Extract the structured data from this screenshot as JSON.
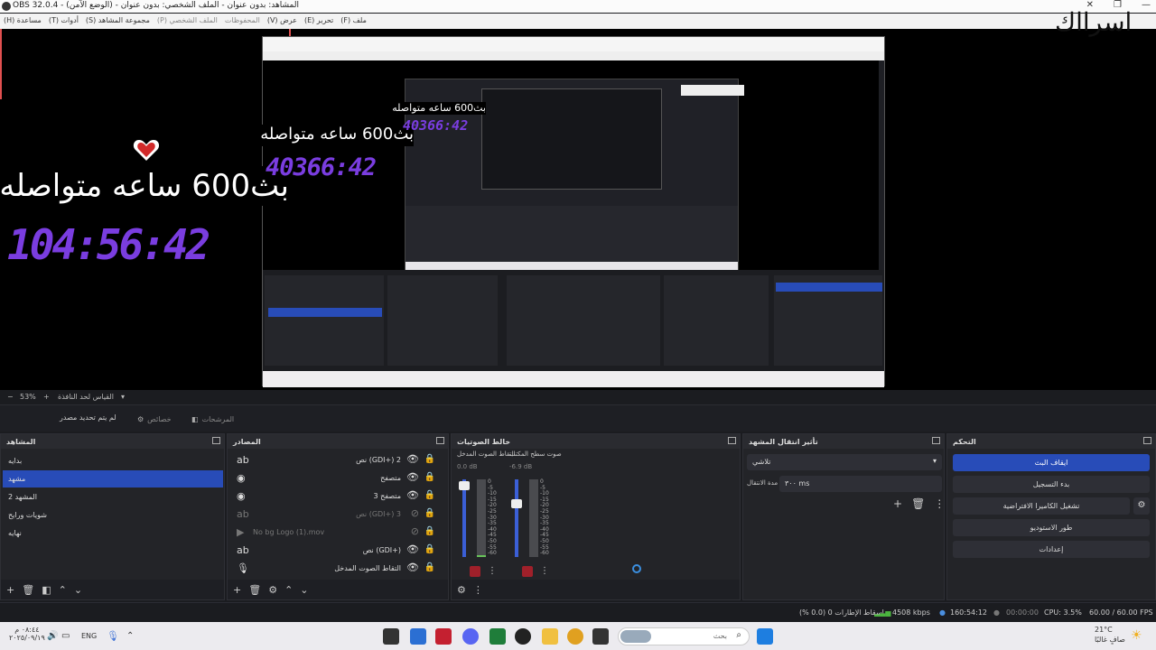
{
  "window": {
    "title": "OBS 32.0.4 - المشاهد: بدون عنوان - الملف الشخصي: بدون عنوان - (الوضع الآمن)",
    "controls": [
      "—",
      "❐",
      "✕"
    ]
  },
  "menu": {
    "items": [
      "ملف (F)",
      "تحرير (E)",
      "عرض (V)",
      "المحفوظات",
      "الملف الشخصي (P)",
      "مجموعة المشاهد (S)",
      "أدوات (T)",
      "مساعدة (H)"
    ]
  },
  "overlay": {
    "channel_title": "اسرااك",
    "stream_text": "بث600 ساعه متواصله",
    "timer_large": "104:56:42",
    "timer_mid": "40366:42",
    "timer_small": "40366:42"
  },
  "zoom": {
    "label": "53%",
    "size_label": "القياس لحد النافذة"
  },
  "bar2": {
    "no_source": "لم يتم تحديد مصدر",
    "properties": "خصائص",
    "filters": "المرشحات"
  },
  "scenes": {
    "title": "المشاهد",
    "items": [
      "بدايه",
      "مشهد",
      "المشهد 2",
      "شويات ورايح",
      "نهايه"
    ],
    "selected_index": 1
  },
  "sources": {
    "title": "المصادر",
    "items": [
      {
        "name": "نص (GDI+) 2",
        "icon": "text-icon",
        "dim": false
      },
      {
        "name": "متصفح",
        "icon": "browser-icon",
        "dim": false
      },
      {
        "name": "متصفح 3",
        "icon": "browser-icon",
        "dim": false
      },
      {
        "name": "نص (GDI+) 3",
        "icon": "text-icon",
        "dim": true
      },
      {
        "name": "No bg Logo (1).mov",
        "icon": "media-icon",
        "dim": true
      },
      {
        "name": "نص (GDI+)",
        "icon": "text-icon",
        "dim": false
      },
      {
        "name": "التقاط الصوت المدخل",
        "icon": "mic-icon",
        "dim": false
      }
    ]
  },
  "mixer": {
    "title": "خالط الصوتيات",
    "channels": [
      {
        "name": "التقاط الصوت المدخل",
        "db": "0.0 dB",
        "level": 0.8
      },
      {
        "name": "صوت سطح المكتب",
        "db": "-6.9 dB",
        "level": 0.6
      }
    ],
    "scale": [
      "0",
      "-5",
      "-10",
      "-15",
      "-20",
      "-25",
      "-30",
      "-35",
      "-40",
      "-45",
      "-50",
      "-55",
      "-60"
    ]
  },
  "transitions": {
    "title": "تأثير انتقال المشهد",
    "selected": "تلاشي",
    "duration_label": "مدة الانتقال",
    "duration_value": "٣٠٠ ms"
  },
  "controls": {
    "title": "التحكم",
    "buttons": [
      "ايقاف البث",
      "بدء التسجيل",
      "تشغيل الكاميرا الافتراضية",
      "طور الاستوديو",
      "إعدادات"
    ]
  },
  "status": {
    "dropped": "إسقاط الإطارات 0 (0.0 %)",
    "bitrate": "4508 kbps",
    "live_time": "160:54:12",
    "rec_time": "00:00:00",
    "cpu": "CPU: 3.5%",
    "fps": "60.00 / 60.00 FPS"
  },
  "taskbar": {
    "search_placeholder": "بحث",
    "weather_temp": "21°C",
    "weather_desc": "صافٍ غالبًا",
    "lang": "ENG",
    "clock_time": "٠٨:٤٤ م",
    "clock_date": "٢٠٢٥/٠٩/١٩"
  }
}
